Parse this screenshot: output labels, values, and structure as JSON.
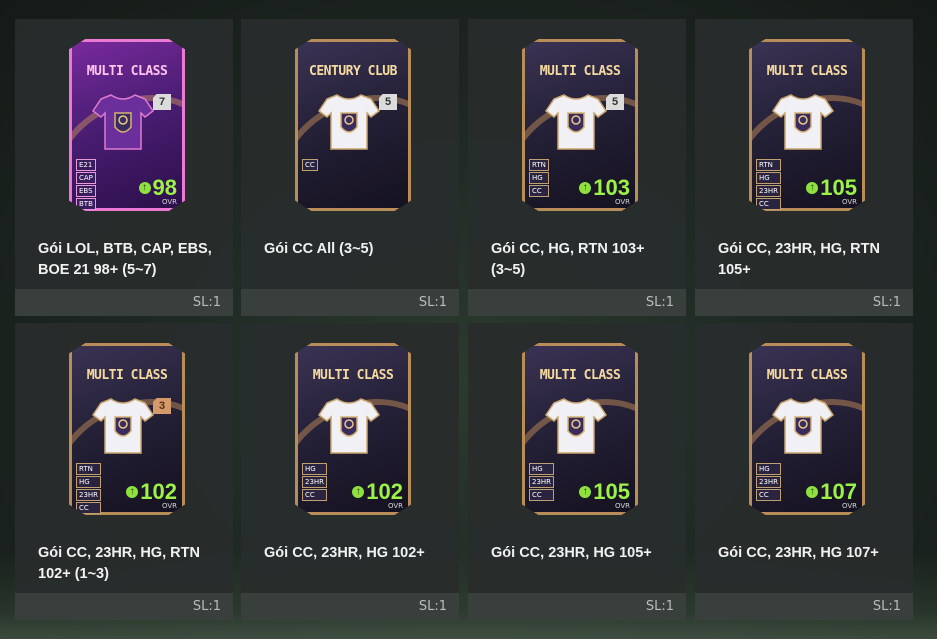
{
  "packs": [
    {
      "name": "Gói LOL, BTB, CAP, EBS, BOE 21 98+ (5~7)",
      "qty": "SL:1",
      "card": {
        "title": "MULTI CLASS",
        "style": "purple",
        "grade": "7",
        "tags": [
          "E21",
          "CAP",
          "EBS",
          "BTB",
          "LOL"
        ],
        "ovr_value": "98",
        "ovr_label": "OVR"
      }
    },
    {
      "name": "Gói CC All (3~5)",
      "qty": "SL:1",
      "card": {
        "title": "CENTURY CLUB",
        "style": "dark",
        "grade": "5",
        "tags": [
          "CC"
        ],
        "ovr_value": "",
        "ovr_label": ""
      }
    },
    {
      "name": "Gói CC, HG, RTN 103+ (3~5)",
      "qty": "SL:1",
      "card": {
        "title": "MULTI CLASS",
        "style": "dark",
        "grade": "5",
        "tags": [
          "RTN",
          "HG",
          "CC"
        ],
        "ovr_value": "103",
        "ovr_label": "OVR"
      }
    },
    {
      "name": "Gói CC, 23HR, HG, RTN 105+",
      "qty": "SL:1",
      "card": {
        "title": "MULTI CLASS",
        "style": "dark",
        "grade": "",
        "tags": [
          "RTN",
          "HG",
          "23HR",
          "CC"
        ],
        "ovr_value": "105",
        "ovr_label": "OVR"
      }
    },
    {
      "name": "Gói CC, 23HR, HG, RTN 102+ (1~3)",
      "qty": "SL:1",
      "card": {
        "title": "MULTI CLASS",
        "style": "dark",
        "grade": "3",
        "tags": [
          "RTN",
          "HG",
          "23HR",
          "CC"
        ],
        "ovr_value": "102",
        "ovr_label": "OVR"
      }
    },
    {
      "name": "Gói CC, 23HR, HG 102+",
      "qty": "SL:1",
      "card": {
        "title": "MULTI CLASS",
        "style": "dark",
        "grade": "",
        "tags": [
          "HG",
          "23HR",
          "CC"
        ],
        "ovr_value": "102",
        "ovr_label": "OVR"
      }
    },
    {
      "name": "Gói CC, 23HR, HG 105+",
      "qty": "SL:1",
      "card": {
        "title": "MULTI CLASS",
        "style": "dark",
        "grade": "",
        "tags": [
          "HG",
          "23HR",
          "CC"
        ],
        "ovr_value": "105",
        "ovr_label": "OVR"
      }
    },
    {
      "name": "Gói CC, 23HR, HG 107+",
      "qty": "SL:1",
      "card": {
        "title": "MULTI CLASS",
        "style": "dark",
        "grade": "",
        "tags": [
          "HG",
          "23HR",
          "CC"
        ],
        "ovr_value": "107",
        "ovr_label": "OVR"
      }
    }
  ],
  "colors": {
    "ovr_green": "#9cf246",
    "tile_bg": "#282d2c",
    "purple_card": "#7b2a9e",
    "gold_border": "#b98d57"
  },
  "icons": {
    "ovr_up": "arrow-up-icon",
    "jersey": "jersey-icon",
    "crest": "crest-icon"
  }
}
